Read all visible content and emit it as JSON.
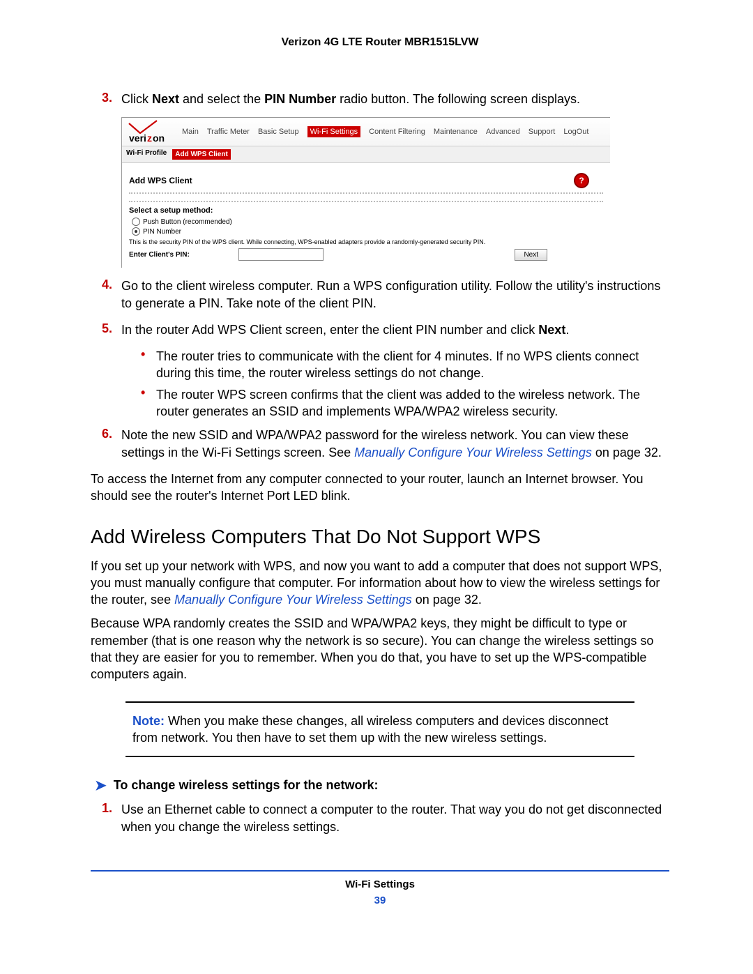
{
  "header": {
    "title": "Verizon 4G LTE Router MBR1515LVW"
  },
  "steps": {
    "s3": {
      "num": "3.",
      "text_a": "Click ",
      "b1": "Next",
      "text_b": " and select the ",
      "b2": "PIN Number",
      "text_c": " radio button. The following screen displays."
    },
    "s4": {
      "num": "4.",
      "text": "Go to the client wireless computer. Run a WPS configuration utility. Follow the utility's instructions to generate a PIN. Take note of the client PIN."
    },
    "s5": {
      "num": "5.",
      "text_a": "In the router Add WPS Client screen, enter the client PIN number and click ",
      "b1": "Next",
      "text_b": "."
    },
    "s6": {
      "num": "6.",
      "text_a": "Note the new SSID and WPA/WPA2 password for the wireless network. You can view these settings in the Wi-Fi Settings screen. See ",
      "link": "Manually Configure Your Wireless Settings",
      "text_b": " on page 32."
    }
  },
  "bullets": {
    "b1": "The router tries to communicate with the client for 4 minutes. If no WPS clients connect during this time, the router wireless settings do not change.",
    "b2": "The router WPS screen confirms that the client was added to the wireless network. The router generates an SSID and implements WPA/WPA2 wireless security."
  },
  "after6": "To access the Internet from any computer connected to your router, launch an Internet browser. You should see the router's Internet Port LED blink.",
  "section": {
    "title": "Add Wireless Computers That Do Not Support WPS"
  },
  "p1": {
    "a": "If you set up your network with WPS, and now you want to add a computer that does not support WPS, you must manually configure that computer. For information about how to view the wireless settings for the router, see ",
    "link": "Manually Configure Your Wireless Settings",
    "b": " on page 32."
  },
  "p2": "Because WPA randomly creates the SSID and WPA/WPA2 keys, they might be difficult to type or remember (that is one reason why the network is so secure). You can change the wireless settings so that they are easier for you to remember. When you do that, you have to set up the WPS-compatible computers again.",
  "note": {
    "label": "Note:",
    "text": "When you make these changes, all wireless computers and devices disconnect from network. You then have to set them up with the new wireless settings."
  },
  "proc": {
    "title": "To change wireless settings for the network:"
  },
  "proc_s1": {
    "num": "1.",
    "text": "Use an Ethernet cable to connect a computer to the router. That way you do not get disconnected when you change the wireless settings."
  },
  "screenshot": {
    "logo_text": "verizon",
    "nav": [
      "Main",
      "Traffic Meter",
      "Basic Setup",
      "Wi-Fi Settings",
      "Content Filtering",
      "Maintenance",
      "Advanced",
      "Support",
      "LogOut"
    ],
    "nav_active_index": 3,
    "subnav": {
      "a": "Wi-Fi Profile",
      "b": "Add WPS Client"
    },
    "title": "Add WPS Client",
    "help": "?",
    "section_title": "Select a setup method:",
    "radio1": "Push Button (recommended)",
    "radio2": "PIN Number",
    "desc": "This is the security PIN of the WPS client. While connecting, WPS-enabled adapters provide a randomly-generated security PIN.",
    "input_label": "Enter Client's PIN:",
    "btn": "Next"
  },
  "footer": {
    "title": "Wi-Fi Settings",
    "page": "39"
  }
}
